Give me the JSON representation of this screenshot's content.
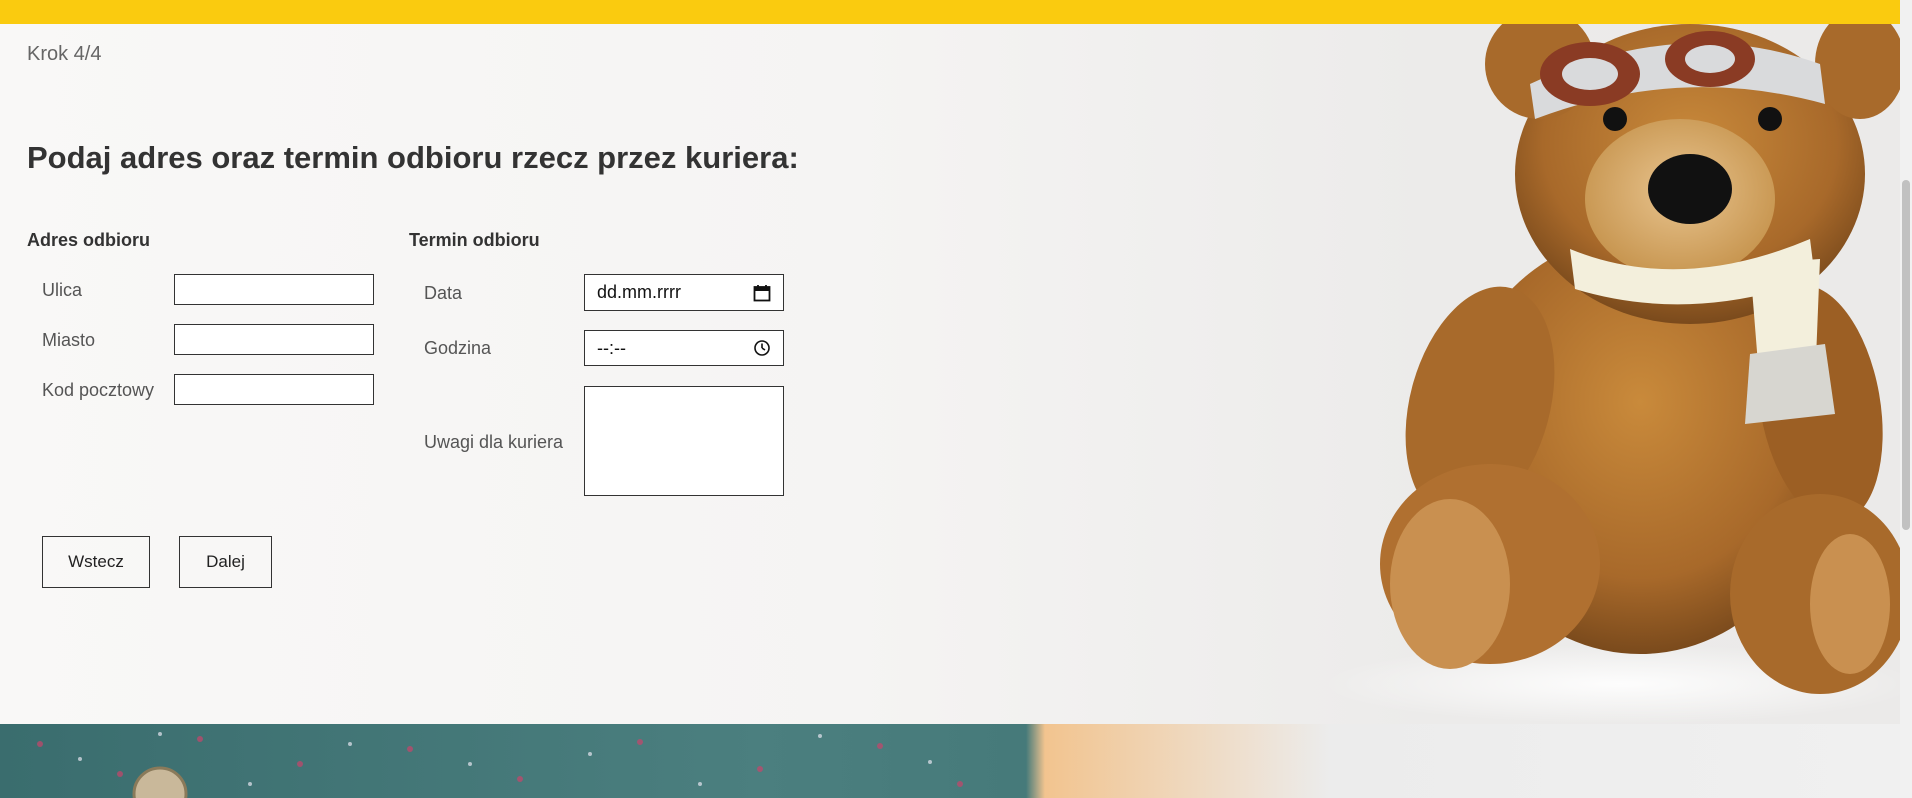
{
  "step": "Krok 4/4",
  "title": "Podaj adres oraz termin odbioru rzecz przez kuriera:",
  "address": {
    "heading": "Adres odbioru",
    "street_label": "Ulica",
    "city_label": "Miasto",
    "postcode_label": "Kod pocztowy"
  },
  "pickup": {
    "heading": "Termin odbioru",
    "date_label": "Data",
    "date_placeholder": "dd.mm.rrrr",
    "time_label": "Godzina",
    "time_placeholder": "--:--",
    "notes_label": "Uwagi dla kuriera"
  },
  "buttons": {
    "back": "Wstecz",
    "next": "Dalej"
  },
  "colors": {
    "top_bar": "#facb0f",
    "hero_background": "#f5f4f3"
  },
  "icons": {
    "date": "calendar-icon",
    "time": "clock-icon"
  }
}
